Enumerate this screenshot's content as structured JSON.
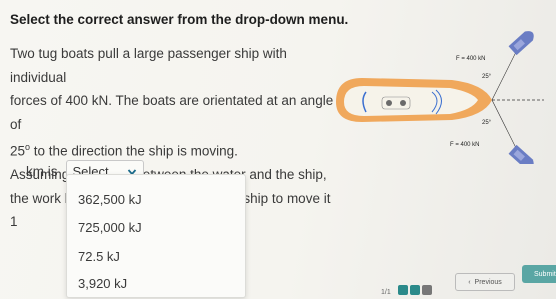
{
  "instruction": "Select the correct answer from the drop-down menu.",
  "question": {
    "line1": "Two tug boats pull a large passenger ship with individual",
    "line2": "forces of 400 kN. The boats are orientated at an angle of",
    "line3_value": "25",
    "line3_unit": "o",
    "line3_rest": " to the direction the ship is moving.",
    "line4": "Assuming no friction between the water and the ship,",
    "line5": "the work being done on the passenger ship to move it 1"
  },
  "answer": {
    "prefix": "km is",
    "select_label": "Select...",
    "suffix": "."
  },
  "dropdown_options": [
    "362,500 kJ",
    "725,000 kJ",
    "72.5 kJ",
    "3,920 kJ"
  ],
  "figure": {
    "force_top": "F = 400 kN",
    "force_bottom": "F = 400 kN",
    "angle_top": "25°",
    "angle_bottom": "25°"
  },
  "footer": {
    "page": "1/1",
    "previous_label": "Previous",
    "submit_label": "Submit"
  },
  "colors": {
    "accent": "#5aa6a4",
    "ship_hull": "#f0a85c",
    "ship_deck": "#f6f3ea",
    "tug": "#6a7dc4"
  }
}
